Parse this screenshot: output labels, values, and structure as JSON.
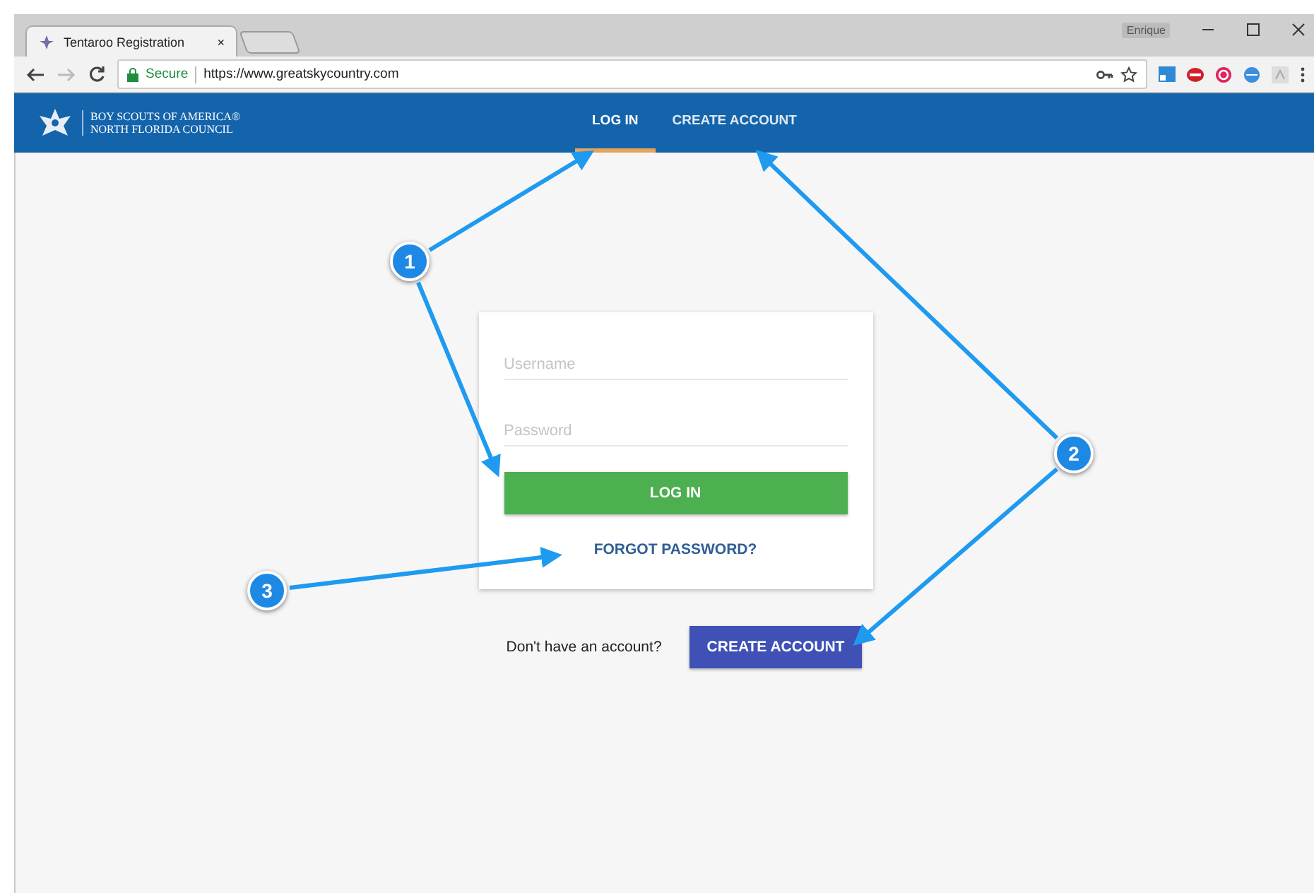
{
  "browser": {
    "tab_title": "Tentaroo Registration",
    "tab_close": "×",
    "profile": "Enrique",
    "security": "Secure",
    "url": "https://www.greatskycountry.com"
  },
  "site_nav": {
    "brand_line_1": "BOY SCOUTS OF AMERICA®",
    "brand_line_2": "NORTH FLORIDA COUNCIL",
    "links": [
      {
        "label": "LOG IN",
        "selected": true
      },
      {
        "label": "CREATE ACCOUNT",
        "selected": false
      }
    ]
  },
  "login_form": {
    "username": {
      "placeholder": "Username"
    },
    "password": {
      "placeholder": "Password"
    },
    "submit": "LOG IN",
    "forgot_link": "FORGOT PASSWORD?"
  },
  "signup": {
    "prompt": "Don't have an account?",
    "button": "CREATE ACCOUNT"
  },
  "callouts": [
    {
      "label": "1"
    },
    {
      "label": "2"
    },
    {
      "label": "3"
    }
  ]
}
